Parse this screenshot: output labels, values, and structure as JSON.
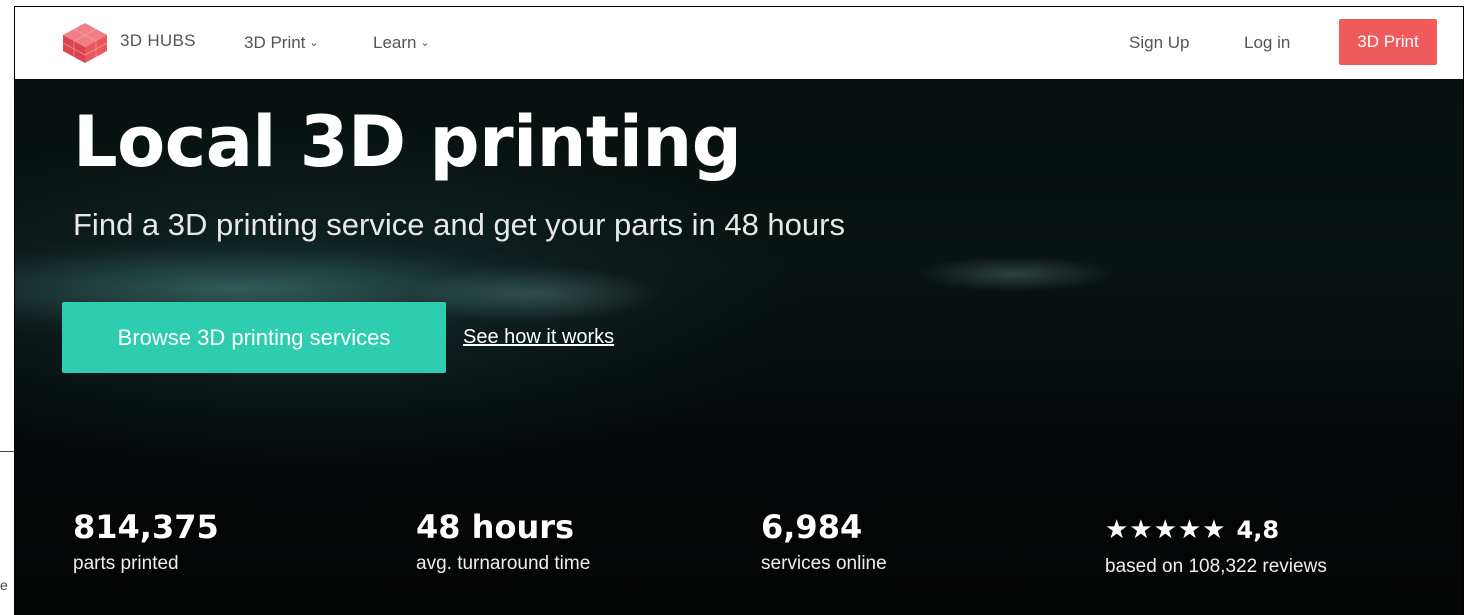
{
  "nav": {
    "brand": "3D HUBS",
    "print_label": "3D Print",
    "learn_label": "Learn",
    "signup_label": "Sign Up",
    "login_label": "Log in",
    "cta_label": "3D Print"
  },
  "hero": {
    "title": "Local 3D printing",
    "subtitle": "Find a 3D printing service and get your parts in 48 hours",
    "browse_label": "Browse 3D printing services",
    "how_label": "See how it works"
  },
  "stats": [
    {
      "value": "814,375",
      "label": "parts printed"
    },
    {
      "value": "48 hours",
      "label": "avg. turnaround time"
    },
    {
      "value": "6,984",
      "label": "services online"
    },
    {
      "stars": "★★★★★",
      "value": "4,8",
      "label": "based on 108,322 reviews"
    }
  ],
  "colors": {
    "cta": "#ef5a5a",
    "accent": "#2ecdb0",
    "logo": "#e8565e"
  },
  "icons": {
    "logo": "3d-hubs-cube-logo",
    "dropdown": "chevron-down-icon"
  }
}
